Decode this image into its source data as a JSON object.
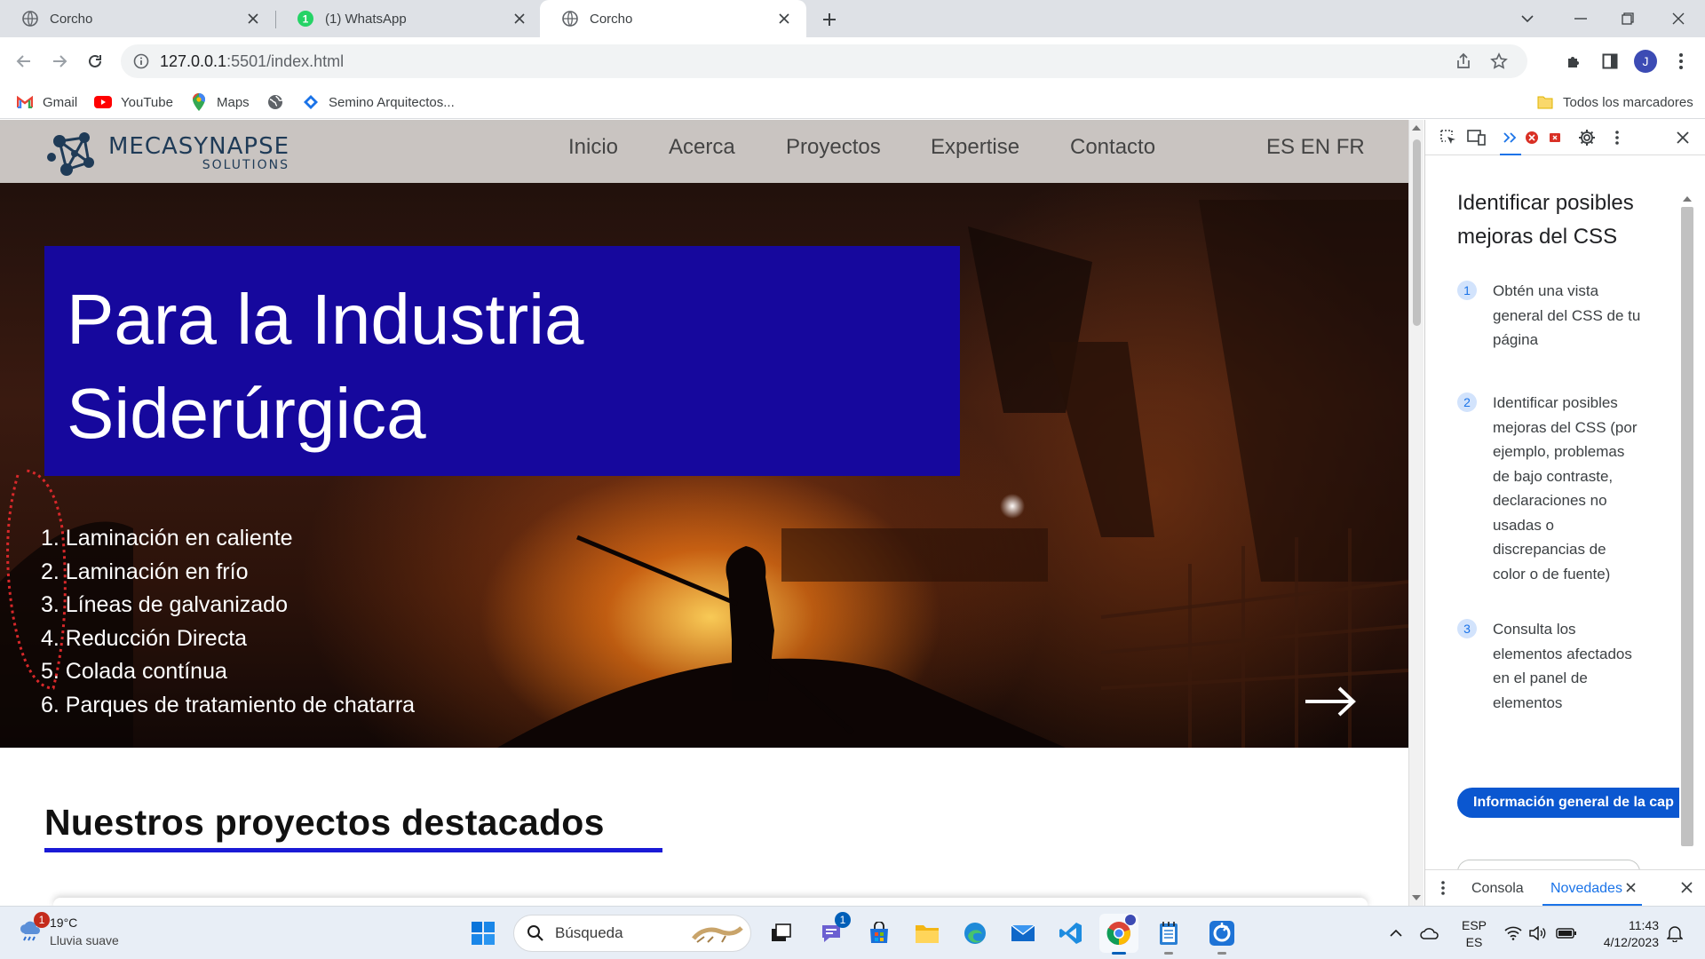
{
  "browser": {
    "tabs": [
      {
        "title": "Corcho",
        "icon": "globe-icon",
        "active": false
      },
      {
        "title": "(1) WhatsApp",
        "icon": "whatsapp-icon",
        "active": false
      },
      {
        "title": "Corcho",
        "icon": "globe-icon",
        "active": true
      }
    ],
    "url_host": "127.0.0.1",
    "url_path": ":5501/index.html",
    "profile_initial": "J",
    "bookmarks": [
      {
        "label": "Gmail",
        "icon": "gmail-icon"
      },
      {
        "label": "YouTube",
        "icon": "youtube-icon"
      },
      {
        "label": "Maps",
        "icon": "maps-icon"
      },
      {
        "label": "",
        "icon": "globe-icon"
      },
      {
        "label": "Semino Arquitectos...",
        "icon": "diamond-icon"
      }
    ],
    "all_bookmarks_label": "Todos los marcadores"
  },
  "site": {
    "logo_main": "MECASYNAPSE",
    "logo_sub": "SOLUTIONS",
    "nav": [
      "Inicio",
      "Acerca",
      "Proyectos",
      "Expertise",
      "Contacto"
    ],
    "languages": "ES EN FR",
    "hero_title": "Para la Industria Siderúrgica",
    "hero_items": [
      "1. Laminación en caliente",
      "2. Laminación en frío",
      "3. Líneas de galvanizado",
      "4. Reducción Directa",
      "5. Colada contínua",
      "6. Parques de tratamiento de chatarra"
    ],
    "projects_title": "Nuestros proyectos destacados",
    "colors": {
      "hero_box": "#16089d",
      "underline": "#1a1ad6",
      "logo": "#1f3b57"
    }
  },
  "devtools": {
    "heading": "Identificar posibles mejoras del CSS",
    "steps": [
      {
        "num": "1",
        "text": "Obtén una vista general del CSS de tu página"
      },
      {
        "num": "2",
        "text": "Identificar posibles mejoras del CSS (por ejemplo, problemas de bajo contraste, declaraciones no usadas o discrepancias de color o de fuente)"
      },
      {
        "num": "3",
        "text": "Consulta los elementos afectados en el panel de elementos"
      }
    ],
    "button_label": "Información general de la cap",
    "drawer_tabs": {
      "console": "Consola",
      "whats_new": "Novedades"
    }
  },
  "taskbar": {
    "weather_temp": "19°C",
    "weather_desc": "Lluvia suave",
    "weather_badge": "1",
    "search_placeholder": "Búsqueda",
    "teams_badge": "1",
    "lang_top": "ESP",
    "lang_bottom": "ES",
    "time": "11:43",
    "date": "4/12/2023"
  }
}
